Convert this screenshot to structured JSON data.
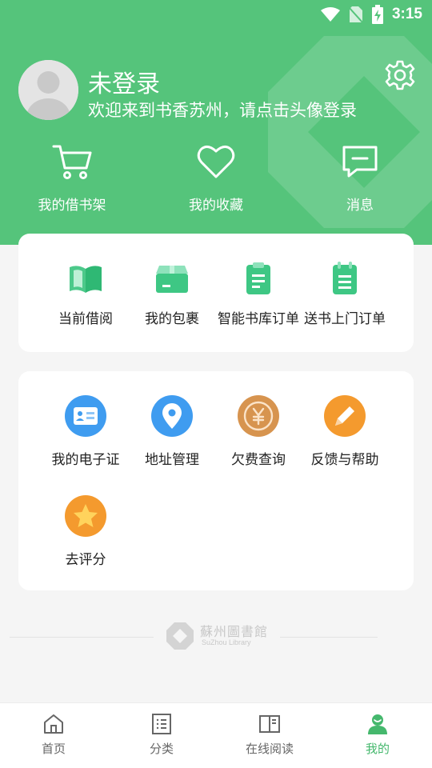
{
  "status": {
    "time": "3:15",
    "icons": [
      "wifi-icon",
      "no-sim-icon",
      "battery-charging-icon"
    ]
  },
  "profile": {
    "title": "未登录",
    "subtitle": "欢迎来到书香苏州，请点击头像登录"
  },
  "quick": [
    {
      "label": "我的借书架",
      "icon": "cart-icon"
    },
    {
      "label": "我的收藏",
      "icon": "heart-icon"
    },
    {
      "label": "消息",
      "icon": "message-icon"
    }
  ],
  "services": [
    {
      "label": "当前借阅",
      "icon": "open-book-icon"
    },
    {
      "label": "我的包裹",
      "icon": "package-icon"
    },
    {
      "label": "智能书库订单",
      "icon": "clipboard-icon"
    },
    {
      "label": "送书上门订单",
      "icon": "notepad-icon"
    }
  ],
  "tools": [
    {
      "label": "我的电子证",
      "icon": "id-card-icon"
    },
    {
      "label": "地址管理",
      "icon": "location-pin-icon"
    },
    {
      "label": "欠费查询",
      "icon": "yuan-coin-icon"
    },
    {
      "label": "反馈与帮助",
      "icon": "pencil-icon"
    },
    {
      "label": "去评分",
      "icon": "star-icon"
    }
  ],
  "footer": {
    "logo_text": "蘇州圖書館",
    "logo_sub": "SuZhou Library"
  },
  "tabs": [
    {
      "label": "首页",
      "icon": "home-icon",
      "active": false
    },
    {
      "label": "分类",
      "icon": "category-list-icon",
      "active": false
    },
    {
      "label": "在线阅读",
      "icon": "book-icon",
      "active": false
    },
    {
      "label": "我的",
      "icon": "profile-icon",
      "active": true
    }
  ],
  "colors": {
    "brand_green": "#55c47b",
    "active_tab": "#45b86d"
  }
}
